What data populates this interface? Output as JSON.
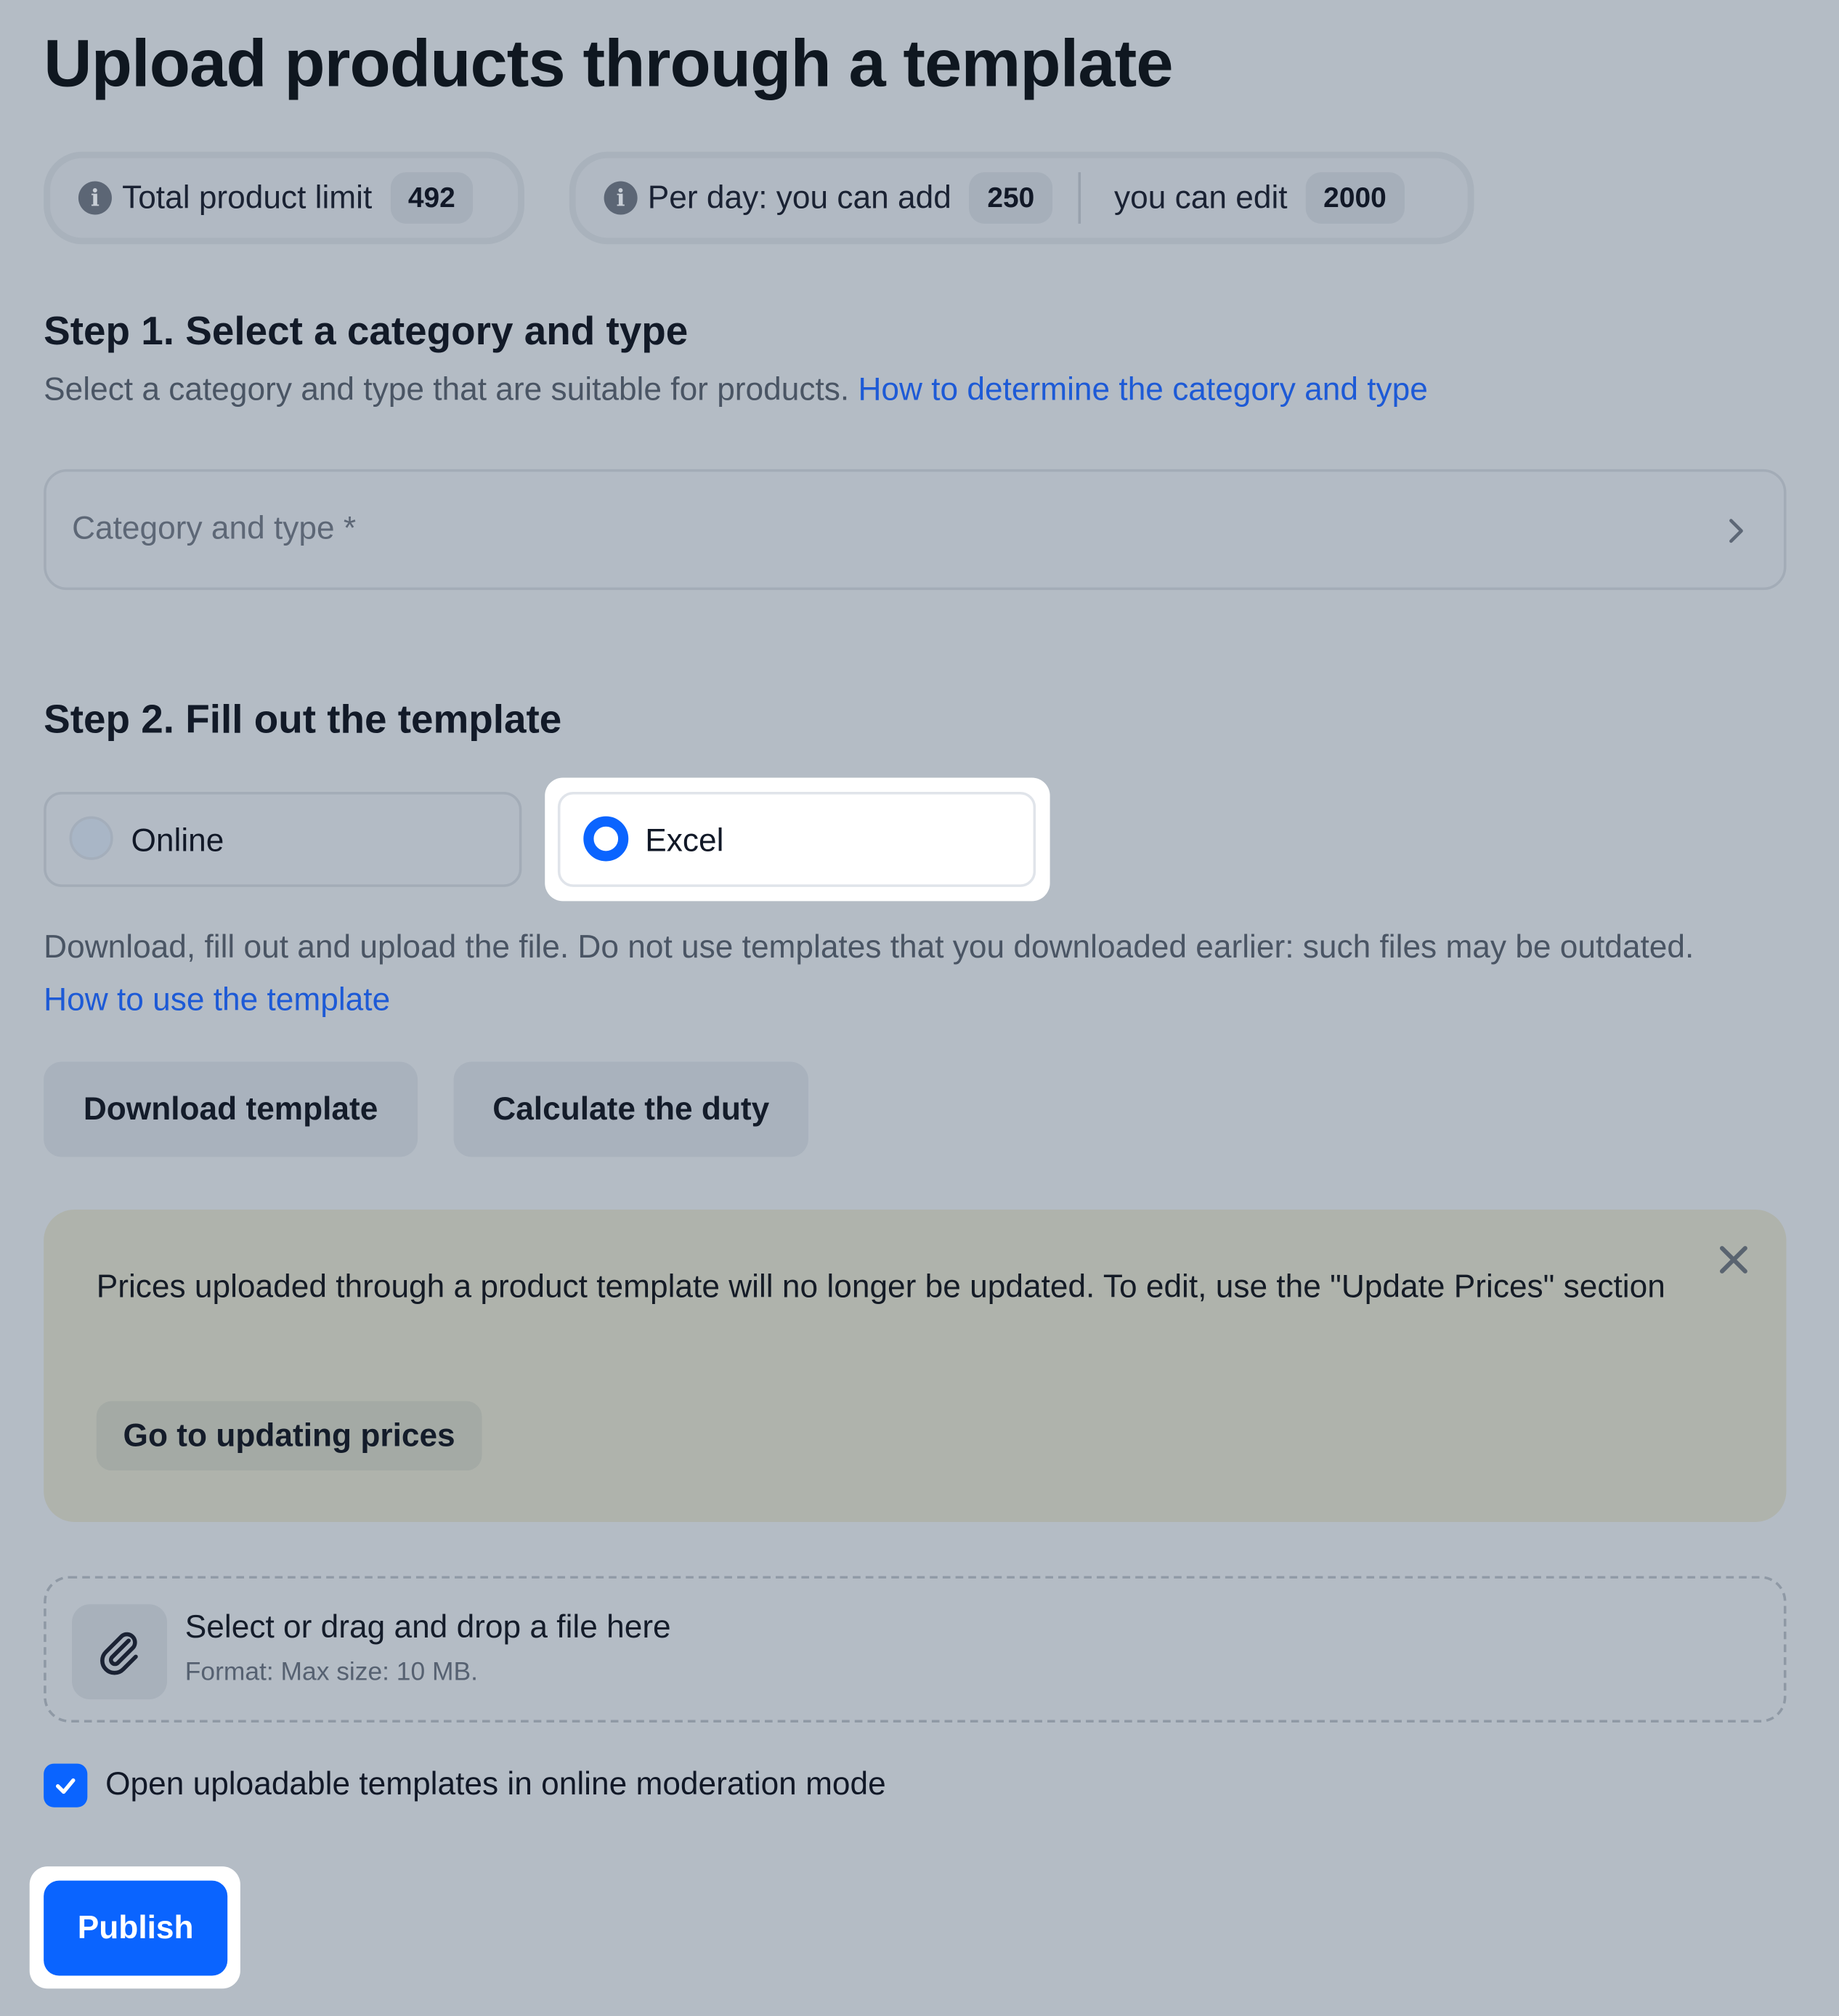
{
  "page": {
    "title": "Upload products through a template"
  },
  "limits": {
    "total_label": "Total product limit",
    "total_value": "492",
    "per_day_add_label": "Per day: you can add",
    "per_day_add_value": "250",
    "per_day_edit_label": "you can edit",
    "per_day_edit_value": "2000",
    "info_icon": "info-icon"
  },
  "step1": {
    "heading": "Step 1. Select a category and type",
    "description": "Select a category and type that are suitable for products.",
    "link": "How to determine the category and type",
    "select_placeholder": "Category and type *",
    "select_icon": "chevron-right-icon"
  },
  "step2": {
    "heading": "Step 2. Fill out the template",
    "options": [
      {
        "label": "Online",
        "selected": false
      },
      {
        "label": "Excel",
        "selected": true
      }
    ],
    "description": "Download, fill out and upload the file. Do not use templates that you downloaded earlier: such files may be outdated.",
    "link": "How to use the template",
    "download_button": "Download template",
    "duty_button": "Calculate the duty"
  },
  "notice": {
    "text": "Prices uploaded through a product template will no longer be updated. To edit, use the \"Update Prices\" section",
    "button": "Go to updating prices",
    "close_icon": "close-icon"
  },
  "upload": {
    "title": "Select or drag and drop a file here",
    "subtitle": "Format: Max size: 10 MB.",
    "icon": "paperclip-icon"
  },
  "moderation": {
    "checked": true,
    "label": "Open uploadable templates in online moderation mode"
  },
  "actions": {
    "publish": "Publish"
  },
  "colors": {
    "accent": "#0a64ff",
    "link": "#1d5ad6",
    "background": "#b4bcc5",
    "notice": "#afb3ac"
  }
}
